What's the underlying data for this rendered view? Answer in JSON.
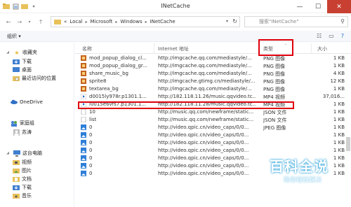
{
  "window": {
    "title": "INetCache"
  },
  "address": {
    "crumbs": [
      "«",
      "Local",
      "Microsoft",
      "Windows",
      "INetCache"
    ]
  },
  "search": {
    "placeholder": "搜索\"INetCache\""
  },
  "toolbar": {
    "organize": "组织 ▾"
  },
  "nav": {
    "items": [
      {
        "label": "收藏夹",
        "icon": "star-icon",
        "level": 0
      },
      {
        "label": "下载",
        "icon": "download-folder-icon",
        "level": 1
      },
      {
        "label": "桌面",
        "icon": "desktop-icon",
        "level": 1
      },
      {
        "label": "最近访问的位置",
        "icon": "recent-places-icon",
        "level": 1
      },
      {
        "label": "OneDrive",
        "icon": "cloud-icon",
        "level": 0
      },
      {
        "label": "家庭组",
        "icon": "homegroup-icon",
        "level": 0
      },
      {
        "label": "苏涛",
        "icon": "user-icon",
        "level": 1
      },
      {
        "label": "这台电脑",
        "icon": "computer-icon",
        "level": 0
      },
      {
        "label": "视频",
        "icon": "videos-folder-icon",
        "level": 1
      },
      {
        "label": "图片",
        "icon": "pictures-folder-icon",
        "level": 1
      },
      {
        "label": "文档",
        "icon": "documents-folder-icon",
        "level": 1
      },
      {
        "label": "下载",
        "icon": "download-folder-icon",
        "level": 1
      },
      {
        "label": "音乐",
        "icon": "music-folder-icon",
        "level": 1
      }
    ]
  },
  "columns": {
    "name": "名称",
    "url": "Internet 地址",
    "type": "类型",
    "size": "大小"
  },
  "files": [
    {
      "name": "mod_popup_dialog_cl...",
      "url": "http://imgcache.qq.com/mediastyle/...",
      "type": "PNG 图像",
      "size": "1 KB",
      "icon": "image-file-icon"
    },
    {
      "name": "mod_popup_dialog_gr...",
      "url": "http://imgcache.qq.com/mediastyle/...",
      "type": "PNG 图像",
      "size": "1 KB",
      "icon": "image-file-icon"
    },
    {
      "name": "share_music_bg",
      "url": "http://imgcache.qq.com/mediastyle/...",
      "type": "PNG 图像",
      "size": "4 KB",
      "icon": "image-file-icon"
    },
    {
      "name": "sprite8",
      "url": "http://imgcache.gtimg.cn/mediastyle/...",
      "type": "PNG 图像",
      "size": "12 KB",
      "icon": "image-file-icon"
    },
    {
      "name": "textarea_bg",
      "url": "http://imgcache.qq.com/mediastyle/...",
      "type": "PNG 图像",
      "size": "1 KB",
      "icon": "image-file-icon"
    },
    {
      "name": "d0015ly978r.p1301.1...",
      "url": "http://182.118.11.26/music.qqvideo.tc...",
      "type": "MP4 视频",
      "size": "37,016...",
      "icon": "video-file-icon"
    },
    {
      "name": "l0015e6vfs7.p1301.1...",
      "url": "http://182.118.11.28/music.qqvideo.tc...",
      "type": "MP4 视频",
      "size": "1 KB",
      "icon": "video-file-icon"
    },
    {
      "name": "10",
      "url": "http://music.qq.com/newframe/static...",
      "type": "JSON 文件",
      "size": "1 KB",
      "icon": "generic-file-icon"
    },
    {
      "name": "list",
      "url": "http://music.qq.com/newframe/static...",
      "type": "JSON 文件",
      "size": "1 KB",
      "icon": "generic-file-icon"
    },
    {
      "name": "0",
      "url": "http://video.qpic.cn/video_caps/0/0...",
      "type": "JPEG 图像",
      "size": "1 KB",
      "icon": "jpeg-file-icon"
    },
    {
      "name": "0",
      "url": "http://video.qpic.cn/video_caps/0/0...",
      "type": "",
      "size": "1 KB",
      "icon": "jpeg-file-icon"
    },
    {
      "name": "0",
      "url": "http://video.qpic.cn/video_caps/0/0...",
      "type": "",
      "size": "1 KB",
      "icon": "jpeg-file-icon"
    },
    {
      "name": "0",
      "url": "http://video.qpic.cn/video_caps/0/0...",
      "type": "",
      "size": "1 KB",
      "icon": "jpeg-file-icon"
    },
    {
      "name": "0",
      "url": "http://video.qpic.cn/video_caps/0/0...",
      "type": "",
      "size": "1 KB",
      "icon": "jpeg-file-icon"
    },
    {
      "name": "0",
      "url": "http://video.qpic.cn/video_caps/0/0...",
      "type": "",
      "size": "1 KB",
      "icon": "jpeg-file-icon"
    },
    {
      "name": "0",
      "url": "http://video.qpic.cn/video_caps/0/0...",
      "type": "",
      "size": "1 KB",
      "icon": "jpeg-file-icon"
    }
  ],
  "watermark": {
    "title": "百科全说",
    "subtitle": "助你轻松解决"
  },
  "colors": {
    "highlight": "#e0000c",
    "close": "#c84031",
    "folder": "#e8c15a",
    "watermark": "#3aa9de"
  }
}
